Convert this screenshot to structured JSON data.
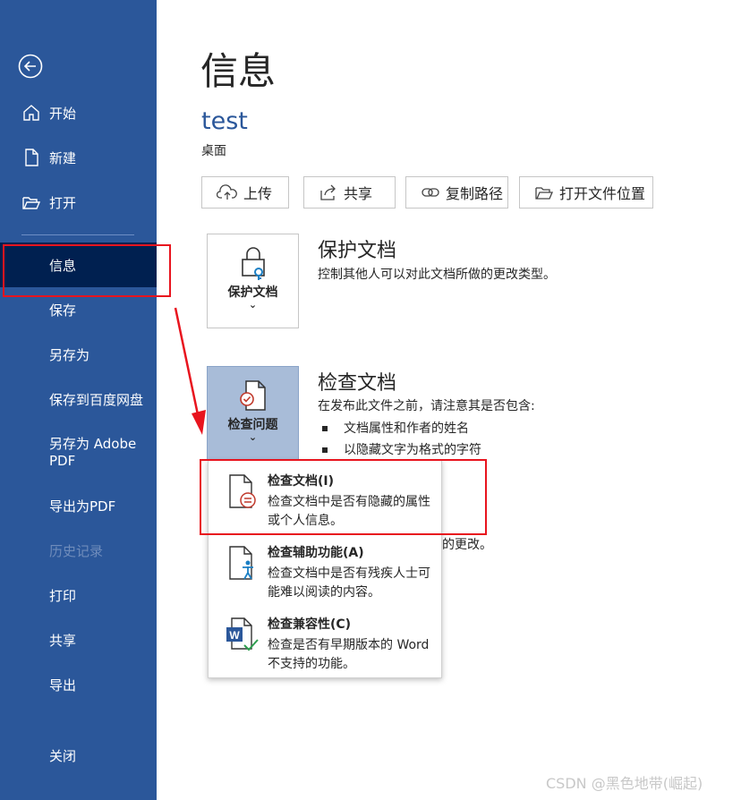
{
  "sidebar": {
    "items": [
      {
        "label": "开始",
        "icon": "home-icon"
      },
      {
        "label": "新建",
        "icon": "new-document-icon"
      },
      {
        "label": "打开",
        "icon": "folder-open-icon"
      },
      {
        "label": "信息"
      },
      {
        "label": "保存"
      },
      {
        "label": "另存为"
      },
      {
        "label": "保存到百度网盘"
      },
      {
        "label": "另存为 Adobe PDF"
      },
      {
        "label": "导出为PDF"
      },
      {
        "label": "历史记录"
      },
      {
        "label": "打印"
      },
      {
        "label": "共享"
      },
      {
        "label": "导出"
      },
      {
        "label": "关闭"
      }
    ]
  },
  "main": {
    "title": "信息",
    "doc_name": "test",
    "doc_location": "桌面",
    "actions": [
      {
        "label": "上传",
        "icon": "upload-cloud-icon"
      },
      {
        "label": "共享",
        "icon": "share-icon"
      },
      {
        "label": "复制路径",
        "icon": "link-icon"
      },
      {
        "label": "打开文件位置",
        "icon": "folder-open-icon"
      }
    ],
    "protect": {
      "button_label": "保护文档",
      "chevron": "⌄",
      "title": "保护文档",
      "description": "控制其他人可以对此文档所做的更改类型。"
    },
    "inspect": {
      "button_label": "检查问题",
      "chevron": "⌄",
      "title": "检查文档",
      "description": "在发布此文件之前，请注意其是否包含:",
      "bullets": [
        "文档属性和作者的姓名",
        "以隐藏文字为格式的字符"
      ],
      "partial_text": "的更改。"
    }
  },
  "menu": {
    "items": [
      {
        "title": "检查文档(I)",
        "description": "检查文档中是否有隐藏的属性或个人信息。"
      },
      {
        "title": "检查辅助功能(A)",
        "description": "检查文档中是否有残疾人士可能难以阅读的内容。"
      },
      {
        "title": "检查兼容性(C)",
        "description": "检查是否有早期版本的 Word 不支持的功能。"
      }
    ]
  },
  "watermark": "CSDN @黑色地带(崛起)",
  "colors": {
    "sidebar": "#2b579a",
    "selected": "#002050",
    "accent": "#2b579a",
    "highlight": "#e8141e"
  }
}
